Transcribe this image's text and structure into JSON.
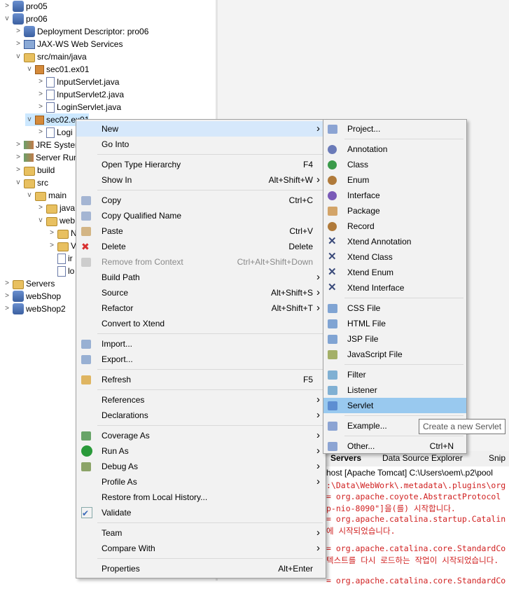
{
  "tree": [
    {
      "label": "pro05",
      "icon": "project-icon",
      "toggle": ">"
    },
    {
      "label": "pro06",
      "icon": "project-icon",
      "toggle": "v"
    },
    {
      "label": "Deployment Descriptor: pro06",
      "icon": "descriptor-icon",
      "toggle": ">"
    },
    {
      "label": "JAX-WS Web Services",
      "icon": "webservice-icon",
      "toggle": ">"
    },
    {
      "label": "src/main/java",
      "icon": "source-folder-icon",
      "toggle": "v"
    },
    {
      "label": "sec01.ex01",
      "icon": "package-icon",
      "toggle": "v"
    },
    {
      "label": "InputServlet.java",
      "icon": "java-file-icon",
      "toggle": ">"
    },
    {
      "label": "InputServlet2.java",
      "icon": "java-file-icon",
      "toggle": ">"
    },
    {
      "label": "LoginServlet.java",
      "icon": "java-file-icon",
      "toggle": ">"
    },
    {
      "label": "sec02.ex01",
      "icon": "package-icon",
      "toggle": "v"
    },
    {
      "label": "Logi",
      "icon": "java-file-icon",
      "toggle": ">"
    },
    {
      "label": "JRE Syster",
      "icon": "library-icon",
      "toggle": ">"
    },
    {
      "label": "Server Run",
      "icon": "library-icon",
      "toggle": ">"
    },
    {
      "label": "build",
      "icon": "folder-icon",
      "toggle": ">"
    },
    {
      "label": "src",
      "icon": "folder-icon",
      "toggle": "v"
    },
    {
      "label": "main",
      "icon": "folder-icon",
      "toggle": "v"
    },
    {
      "label": "java",
      "icon": "folder-icon",
      "toggle": ">"
    },
    {
      "label": "web",
      "icon": "folder-icon",
      "toggle": "v"
    },
    {
      "label": "N",
      "icon": "folder-icon",
      "toggle": ">"
    },
    {
      "label": "V",
      "icon": "folder-icon",
      "toggle": ">"
    },
    {
      "label": "ir",
      "icon": "file-icon",
      "toggle": ""
    },
    {
      "label": "lo",
      "icon": "file-icon",
      "toggle": ""
    },
    {
      "label": "Servers",
      "icon": "folder-icon",
      "toggle": ">"
    },
    {
      "label": "webShop",
      "icon": "project-icon",
      "toggle": ">"
    },
    {
      "label": "webShop2",
      "icon": "project-icon",
      "toggle": ">"
    }
  ],
  "context_menu": [
    {
      "label": "New",
      "shortcut": "",
      "submenu": true,
      "icon": ""
    },
    {
      "label": "Go Into",
      "shortcut": "",
      "submenu": false,
      "icon": ""
    },
    {
      "sep": true
    },
    {
      "label": "Open Type Hierarchy",
      "shortcut": "F4",
      "submenu": false,
      "icon": ""
    },
    {
      "label": "Show In",
      "shortcut": "Alt+Shift+W",
      "submenu": true,
      "icon": ""
    },
    {
      "sep": true
    },
    {
      "label": "Copy",
      "shortcut": "Ctrl+C",
      "submenu": false,
      "icon": "copy-icon"
    },
    {
      "label": "Copy Qualified Name",
      "shortcut": "",
      "submenu": false,
      "icon": "copy-qualified-icon"
    },
    {
      "label": "Paste",
      "shortcut": "Ctrl+V",
      "submenu": false,
      "icon": "paste-icon"
    },
    {
      "label": "Delete",
      "shortcut": "Delete",
      "submenu": false,
      "icon": "delete-icon"
    },
    {
      "label": "Remove from Context",
      "shortcut": "Ctrl+Alt+Shift+Down",
      "submenu": false,
      "icon": "remove-context-icon",
      "disabled": true
    },
    {
      "label": "Build Path",
      "shortcut": "",
      "submenu": true,
      "icon": ""
    },
    {
      "label": "Source",
      "shortcut": "Alt+Shift+S",
      "submenu": true,
      "icon": ""
    },
    {
      "label": "Refactor",
      "shortcut": "Alt+Shift+T",
      "submenu": true,
      "icon": ""
    },
    {
      "label": "Convert to Xtend",
      "shortcut": "",
      "submenu": false,
      "icon": ""
    },
    {
      "sep": true
    },
    {
      "label": "Import...",
      "shortcut": "",
      "submenu": false,
      "icon": "import-icon"
    },
    {
      "label": "Export...",
      "shortcut": "",
      "submenu": false,
      "icon": "export-icon"
    },
    {
      "sep": true
    },
    {
      "label": "Refresh",
      "shortcut": "F5",
      "submenu": false,
      "icon": "refresh-icon"
    },
    {
      "sep": true
    },
    {
      "label": "References",
      "shortcut": "",
      "submenu": true,
      "icon": ""
    },
    {
      "label": "Declarations",
      "shortcut": "",
      "submenu": true,
      "icon": ""
    },
    {
      "sep": true
    },
    {
      "label": "Coverage As",
      "shortcut": "",
      "submenu": true,
      "icon": "coverage-icon"
    },
    {
      "label": "Run As",
      "shortcut": "",
      "submenu": true,
      "icon": "run-icon"
    },
    {
      "label": "Debug As",
      "shortcut": "",
      "submenu": true,
      "icon": "debug-icon"
    },
    {
      "label": "Profile As",
      "shortcut": "",
      "submenu": true,
      "icon": ""
    },
    {
      "label": "Restore from Local History...",
      "shortcut": "",
      "submenu": false,
      "icon": ""
    },
    {
      "label": "Validate",
      "shortcut": "",
      "submenu": false,
      "icon": "validate-icon"
    },
    {
      "sep": true
    },
    {
      "label": "Team",
      "shortcut": "",
      "submenu": true,
      "icon": ""
    },
    {
      "label": "Compare With",
      "shortcut": "",
      "submenu": true,
      "icon": ""
    },
    {
      "sep": true
    },
    {
      "label": "Properties",
      "shortcut": "Alt+Enter",
      "submenu": false,
      "icon": ""
    }
  ],
  "submenu": [
    {
      "label": "Project...",
      "icon": "project-wizard-icon",
      "shortcut": ""
    },
    {
      "sep": true
    },
    {
      "label": "Annotation",
      "icon": "annotation-icon",
      "shortcut": ""
    },
    {
      "label": "Class",
      "icon": "class-icon",
      "shortcut": ""
    },
    {
      "label": "Enum",
      "icon": "enum-icon",
      "shortcut": ""
    },
    {
      "label": "Interface",
      "icon": "interface-icon",
      "shortcut": ""
    },
    {
      "label": "Package",
      "icon": "package-icon",
      "shortcut": ""
    },
    {
      "label": "Record",
      "icon": "record-icon",
      "shortcut": ""
    },
    {
      "label": "Xtend Annotation",
      "icon": "xtend-icon",
      "shortcut": ""
    },
    {
      "label": "Xtend Class",
      "icon": "xtend-icon",
      "shortcut": ""
    },
    {
      "label": "Xtend Enum",
      "icon": "xtend-icon",
      "shortcut": ""
    },
    {
      "label": "Xtend Interface",
      "icon": "xtend-icon",
      "shortcut": ""
    },
    {
      "sep": true
    },
    {
      "label": "CSS File",
      "icon": "css-file-icon",
      "shortcut": ""
    },
    {
      "label": "HTML File",
      "icon": "html-file-icon",
      "shortcut": ""
    },
    {
      "label": "JSP File",
      "icon": "jsp-file-icon",
      "shortcut": ""
    },
    {
      "label": "JavaScript File",
      "icon": "javascript-file-icon",
      "shortcut": ""
    },
    {
      "sep": true
    },
    {
      "label": "Filter",
      "icon": "filter-icon",
      "shortcut": ""
    },
    {
      "label": "Listener",
      "icon": "listener-icon",
      "shortcut": ""
    },
    {
      "label": "Servlet",
      "icon": "servlet-icon",
      "shortcut": "",
      "selected": true
    },
    {
      "sep": true
    },
    {
      "label": "Example...",
      "icon": "example-icon",
      "shortcut": ""
    },
    {
      "sep": true
    },
    {
      "label": "Other...",
      "icon": "other-icon",
      "shortcut": "Ctrl+N"
    }
  ],
  "tooltip": "Create a new Servlet",
  "console": {
    "tabs": [
      "Servers",
      "Data Source Explorer",
      "Snip"
    ],
    "title": "host [Apache Tomcat] C:\\Users\\oem\\.p2\\pool",
    "lines": [
      ":\\Data\\WebWork\\.metadata\\.plugins\\org",
      "= org.apache.coyote.AbstractProtocol",
      "p-nio-8090\"]을(를) 시작합니다.",
      "= org.apache.catalina.startup.Catalin",
      "에 시작되었습니다.",
      "",
      "= org.apache.catalina.core.StandardCo",
      "텍스트를 다시 로드하는 작업이 시작되었습니다.",
      "",
      "= org.apache.catalina.core.StandardCo"
    ]
  },
  "colors": {
    "menu_bg": "#f2f2f2",
    "highlight": "#99c9ef",
    "hover": "#d6e8fb",
    "console_text": "#d02020"
  }
}
